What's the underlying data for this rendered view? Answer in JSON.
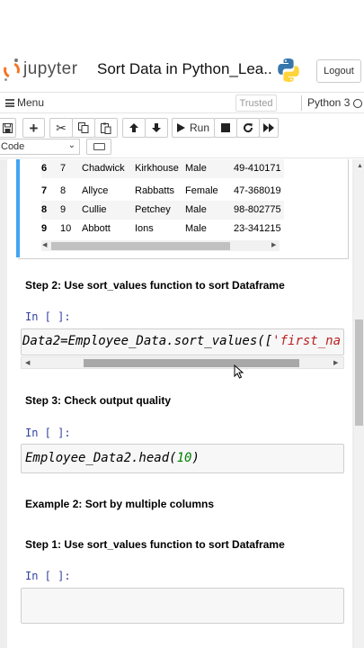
{
  "header": {
    "logo_text": "jupyter",
    "notebook_title": "Sort Data in Python_Lea...",
    "logout_label": "Logout"
  },
  "menubar": {
    "menu_label": "Menu",
    "trusted_label": "Trusted",
    "kernel_name": "Python 3"
  },
  "toolbar": {
    "run_label": "Run",
    "cell_type": "Code"
  },
  "output_table": {
    "rows": [
      {
        "index": "6",
        "c0": "7",
        "c1": "Chadwick",
        "c2": "Kirkhouse",
        "c3": "Male",
        "c4": "49-410171"
      },
      {
        "index": "7",
        "c0": "8",
        "c1": "Allyce",
        "c2": "Rabbatts",
        "c3": "Female",
        "c4": "47-368019"
      },
      {
        "index": "8",
        "c0": "9",
        "c1": "Cullie",
        "c2": "Petchey",
        "c3": "Male",
        "c4": "98-802775"
      },
      {
        "index": "9",
        "c0": "10",
        "c1": "Abbott",
        "c2": "Ions",
        "c3": "Male",
        "c4": "23-341215"
      }
    ]
  },
  "cells": {
    "step2_heading": "Step 2: Use sort_values function to sort Dataframe",
    "prompt": "In [ ]:",
    "code1_part1": "Data2=Employee_Data.sort_values([",
    "code1_string": "'first_na",
    "step3_heading": "Step 3: Check output quality",
    "code2_part1": "Employee_Data2.head(",
    "code2_number": "10",
    "code2_part2": ")",
    "example2_heading": "Example 2: Sort by multiple columns",
    "step1_heading": "Step 1: Use sort_values function to sort Dataframe"
  },
  "colors": {
    "jupyter_orange": "#f37626",
    "selection_blue": "#42a5f5",
    "prompt_blue": "#303f9f",
    "string_red": "#ba2121",
    "number_green": "#008000"
  }
}
